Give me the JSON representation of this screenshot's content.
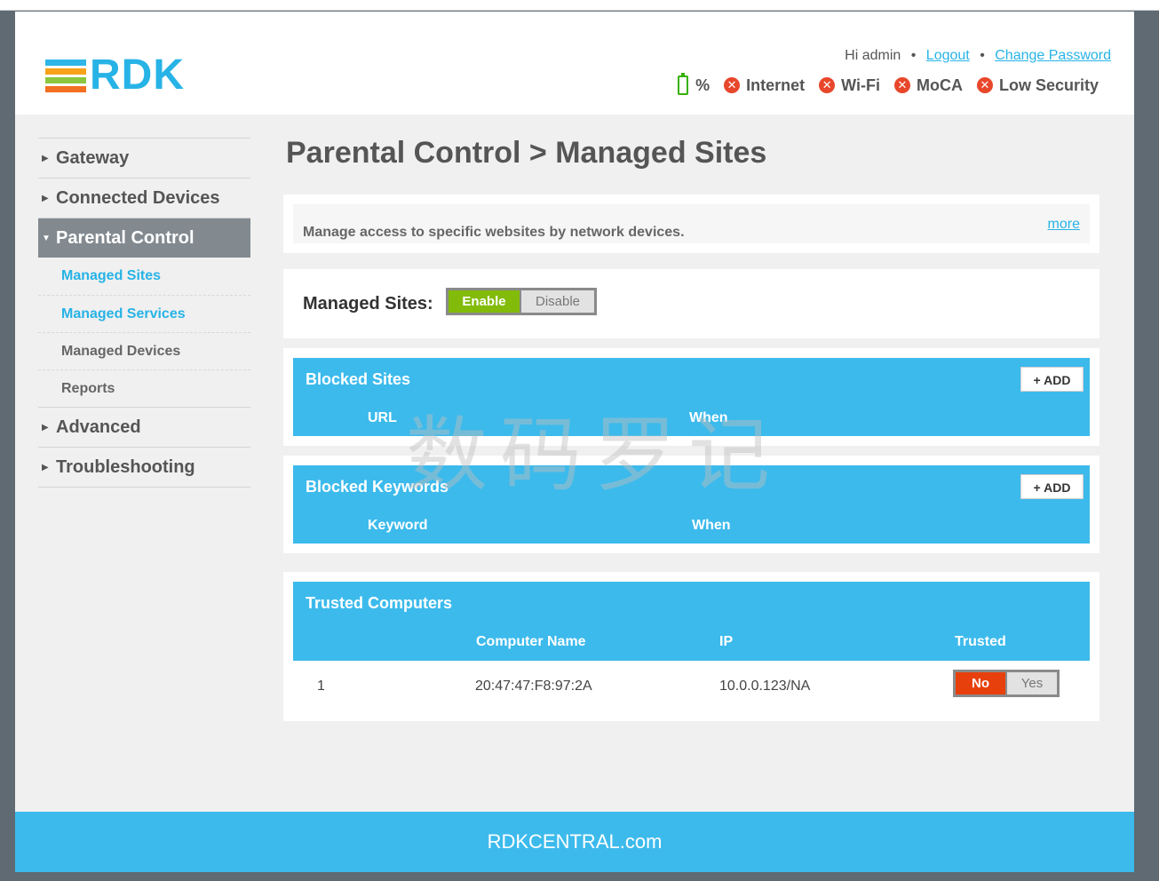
{
  "header": {
    "logo_text": "RDK",
    "greeting": "Hi admin",
    "separator": "•",
    "logout_label": "Logout",
    "change_password_label": "Change Password",
    "status": {
      "battery_label": "%",
      "internet_label": "Internet",
      "wifi_label": "Wi-Fi",
      "moca_label": "MoCA",
      "security_label": "Low Security",
      "status_icon": "x-circle-icon",
      "battery_color": "#38b000",
      "error_color": "#e8472b"
    }
  },
  "sidebar": {
    "items": [
      {
        "label": "Gateway"
      },
      {
        "label": "Connected Devices"
      },
      {
        "label": "Parental Control"
      },
      {
        "label": "Advanced"
      },
      {
        "label": "Troubleshooting"
      }
    ],
    "sub_items": [
      {
        "label": "Managed Sites"
      },
      {
        "label": "Managed Services"
      },
      {
        "label": "Managed Devices"
      },
      {
        "label": "Reports"
      }
    ]
  },
  "main": {
    "title": "Parental Control > Managed Sites",
    "info_text": "Manage access to specific websites by network devices.",
    "more_label": "more",
    "managed_sites_label": "Managed Sites:",
    "enable_label": "Enable",
    "disable_label": "Disable",
    "blocked_sites": {
      "title": "Blocked Sites",
      "add_label": "+ ADD",
      "columns": [
        "URL",
        "When"
      ]
    },
    "blocked_keywords": {
      "title": "Blocked Keywords",
      "add_label": "+ ADD",
      "columns": [
        "Keyword",
        "When"
      ]
    },
    "trusted_computers": {
      "title": "Trusted Computers",
      "columns": [
        "Computer Name",
        "IP",
        "Trusted"
      ],
      "rows": [
        {
          "index": "1",
          "name": "20:47:47:F8:97:2A",
          "ip": "10.0.0.123/NA",
          "no_label": "No",
          "yes_label": "Yes"
        }
      ]
    }
  },
  "watermark": "数码罗记",
  "footer": {
    "text": "RDKCENTRAL.com"
  },
  "colors": {
    "accent": "#3cbaec",
    "enable_green": "#82bb09",
    "no_red": "#e8400c"
  }
}
